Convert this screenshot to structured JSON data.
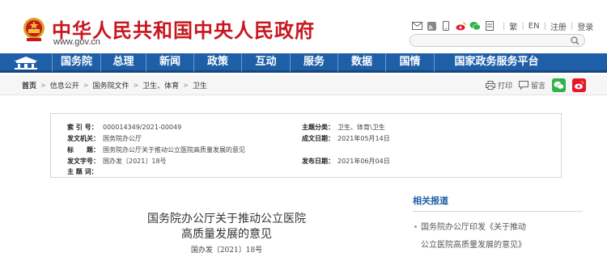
{
  "header": {
    "site_title": "中华人民共和国中央人民政府",
    "site_url": "www.gov.cn",
    "top_links": [
      "繁",
      "EN",
      "注册",
      "登录"
    ],
    "search": {
      "value": "",
      "placeholder": ""
    }
  },
  "nav": {
    "items": [
      "国务院",
      "总理",
      "新闻",
      "政策",
      "互动",
      "服务",
      "数据",
      "国情",
      "国家政务服务平台"
    ]
  },
  "breadcrumb": {
    "items": [
      "首页",
      "信息公开",
      "国务院文件",
      "卫生、体育",
      "卫生"
    ]
  },
  "share": {
    "print_label": "打印",
    "comment_label": "留言"
  },
  "info": {
    "index_label": "索 引 号：",
    "index_value": "000014349/2021-00049",
    "category_label": "主题分类：",
    "category_value": "卫生、体育\\卫生",
    "issuer_label": "发文机关：",
    "issuer_value": "国务院办公厅",
    "date_label": "成文日期：",
    "date_value": "2021年05月14日",
    "title_label": "标　　题：",
    "title_value": "国务院办公厅关于推动公立医院高质量发展的意见",
    "docno_label": "发文字号：",
    "docno_value": "国办发〔2021〕18号",
    "pubdate_label": "发布日期：",
    "pubdate_value": "2021年06月04日",
    "keywords_label": "主 题 词："
  },
  "article": {
    "title_line1": "国务院办公厅关于推动公立医院",
    "title_line2": "高质量发展的意见",
    "docnum": "国办发〔2021〕18号"
  },
  "side": {
    "heading": "相关报道",
    "item_line1": "国务院办公厅印发《关于推动",
    "item_line2": "公立医院高质量发展的意见》"
  },
  "colors": {
    "brand_red": "#c8161e",
    "nav_blue": "#1f5fa8",
    "wechat_green": "#2fb34a",
    "weibo_red": "#e6162d"
  }
}
